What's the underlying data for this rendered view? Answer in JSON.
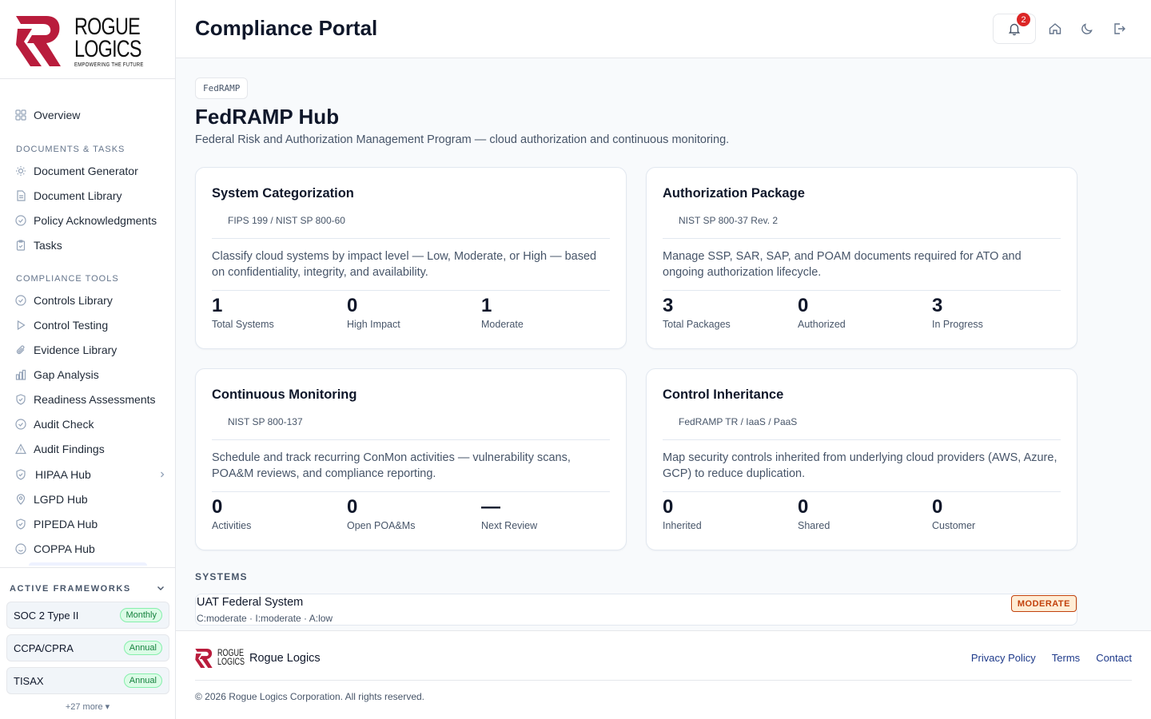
{
  "brand": {
    "logo_line1": "ROGUE",
    "logo_line2": "LOGICS",
    "tagline": "EMPOWERING THE FUTURE",
    "accent": "#b91c3c"
  },
  "sidebar": {
    "overview": "Overview",
    "section_docs": "DOCUMENTS & TASKS",
    "docs_items": [
      "Document Generator",
      "Document Library",
      "Policy Acknowledgments",
      "Tasks"
    ],
    "section_tools": "COMPLIANCE TOOLS",
    "tools_items": [
      "Controls Library",
      "Control Testing",
      "Evidence Library",
      "Gap Analysis",
      "Readiness Assessments",
      "Audit Check",
      "Audit Findings",
      "HIPAA Hub",
      "LGPD Hub",
      "PIPEDA Hub",
      "COPPA Hub"
    ]
  },
  "frameworks": {
    "header": "ACTIVE FRAMEWORKS",
    "items": [
      {
        "name": "SOC 2 Type II",
        "cadence": "Monthly"
      },
      {
        "name": "CCPA/CPRA",
        "cadence": "Annual"
      },
      {
        "name": "TISAX",
        "cadence": "Annual"
      }
    ],
    "more": "+27 more ▾"
  },
  "header": {
    "title": "Compliance Portal",
    "notification_count": "2"
  },
  "main": {
    "breadcrumb": "FedRAMP",
    "title": "FedRAMP Hub",
    "subtitle": "Federal Risk and Authorization Management Program — cloud authorization and continuous monitoring.",
    "cards": [
      {
        "title": "System Categorization",
        "ref": "FIPS 199 / NIST SP 800-60",
        "desc": "Classify cloud systems by impact level — Low, Moderate, or High — based on confidentiality, integrity, and availability.",
        "stats": [
          {
            "num": "1",
            "label": "Total Systems"
          },
          {
            "num": "0",
            "label": "High Impact"
          },
          {
            "num": "1",
            "label": "Moderate"
          }
        ]
      },
      {
        "title": "Authorization Package",
        "ref": "NIST SP 800-37 Rev. 2",
        "desc": "Manage SSP, SAR, SAP, and POAM documents required for ATO and ongoing authorization lifecycle.",
        "stats": [
          {
            "num": "3",
            "label": "Total Packages"
          },
          {
            "num": "0",
            "label": "Authorized"
          },
          {
            "num": "3",
            "label": "In Progress"
          }
        ]
      },
      {
        "title": "Continuous Monitoring",
        "ref": "NIST SP 800-137",
        "desc": "Schedule and track recurring ConMon activities — vulnerability scans, POA&M reviews, and compliance reporting.",
        "stats": [
          {
            "num": "0",
            "label": "Activities"
          },
          {
            "num": "0",
            "label": "Open POA&Ms"
          },
          {
            "num": "—",
            "label": "Next Review"
          }
        ]
      },
      {
        "title": "Control Inheritance",
        "ref": "FedRAMP TR / IaaS / PaaS",
        "desc": "Map security controls inherited from underlying cloud providers (AWS, Azure, GCP) to reduce duplication.",
        "stats": [
          {
            "num": "0",
            "label": "Inherited"
          },
          {
            "num": "0",
            "label": "Shared"
          },
          {
            "num": "0",
            "label": "Customer"
          }
        ]
      }
    ],
    "systems_heading": "SYSTEMS",
    "systems": [
      {
        "name": "UAT Federal System",
        "meta": "C:moderate · I:moderate · A:low",
        "level": "MODERATE"
      }
    ]
  },
  "footer": {
    "logo_line1": "ROGUE",
    "logo_line2": "LOGICS",
    "brand": "Rogue Logics",
    "links": [
      "Privacy Policy",
      "Terms",
      "Contact"
    ],
    "copyright": "© 2026 Rogue Logics Corporation. All rights reserved."
  }
}
